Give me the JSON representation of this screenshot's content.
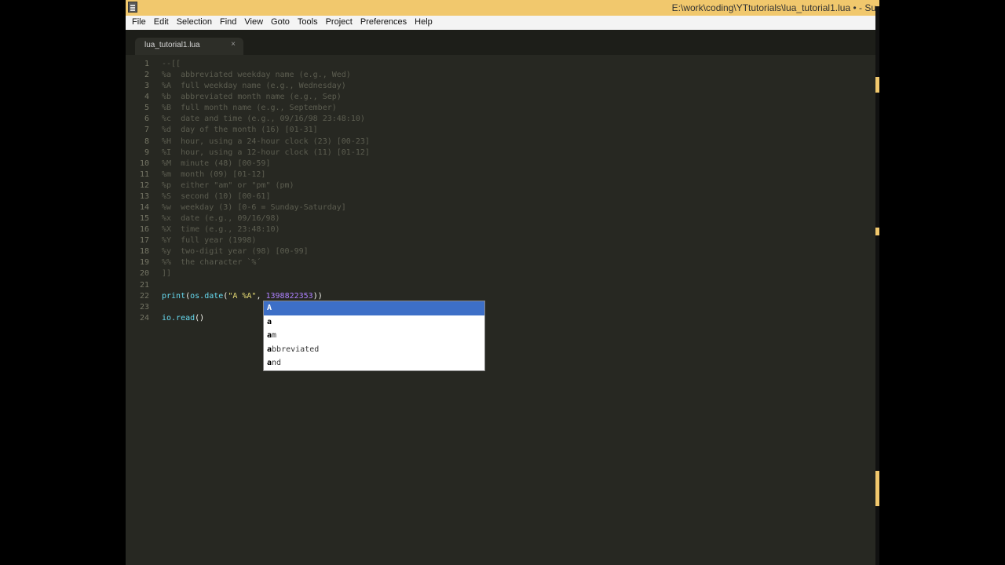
{
  "window": {
    "title": "E:\\work\\coding\\YTtutorials\\lua_tutorial1.lua • - Su"
  },
  "menu": {
    "items": [
      "File",
      "Edit",
      "Selection",
      "Find",
      "View",
      "Goto",
      "Tools",
      "Project",
      "Preferences",
      "Help"
    ]
  },
  "tabs": [
    {
      "label": "lua_tutorial1.lua",
      "close": "×"
    }
  ],
  "editor": {
    "line_numbers": [
      "1",
      "2",
      "3",
      "4",
      "5",
      "6",
      "7",
      "8",
      "9",
      "10",
      "11",
      "12",
      "13",
      "14",
      "15",
      "16",
      "17",
      "18",
      "19",
      "20",
      "21",
      "22",
      "23",
      "24"
    ],
    "lines": [
      "--[[",
      "%a  abbreviated weekday name (e.g., Wed)",
      "%A  full weekday name (e.g., Wednesday)",
      "%b  abbreviated month name (e.g., Sep)",
      "%B  full month name (e.g., September)",
      "%c  date and time (e.g., 09/16/98 23:48:10)",
      "%d  day of the month (16) [01-31]",
      "%H  hour, using a 24-hour clock (23) [00-23]",
      "%I  hour, using a 12-hour clock (11) [01-12]",
      "%M  minute (48) [00-59]",
      "%m  month (09) [01-12]",
      "%p  either \"am\" or \"pm\" (pm)",
      "%S  second (10) [00-61]",
      "%w  weekday (3) [0-6 = Sunday-Saturday]",
      "%x  date (e.g., 09/16/98)",
      "%X  time (e.g., 23:48:10)",
      "%Y  full year (1998)",
      "%y  two-digit year (98) [00-99]",
      "%%  the character `%´",
      "]]",
      "",
      "",
      "",
      ""
    ],
    "line22": {
      "fn": "print",
      "open": "(",
      "obj": "os.date",
      "open2": "(",
      "str": "\"A %A\"",
      "comma": ", ",
      "num": "1398822353",
      "close": "))"
    },
    "line24": {
      "fn": "io.read",
      "args": "()"
    }
  },
  "autocomplete": {
    "items": [
      {
        "match": "A",
        "rest": ""
      },
      {
        "match": "a",
        "rest": ""
      },
      {
        "match": "a",
        "rest": "m"
      },
      {
        "match": "a",
        "rest": "bbreviated"
      },
      {
        "match": "a",
        "rest": "nd"
      }
    ]
  }
}
